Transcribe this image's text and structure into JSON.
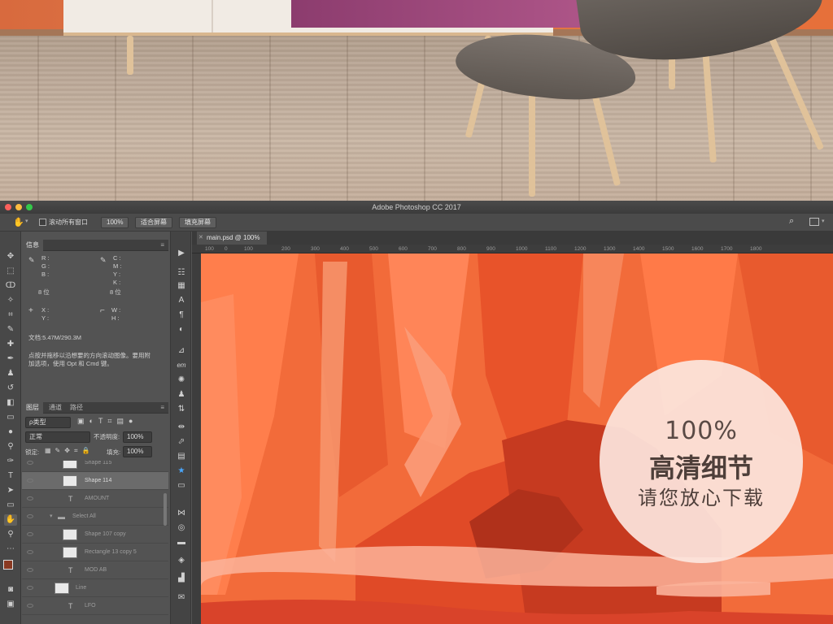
{
  "app": {
    "title": "Adobe Photoshop CC 2017"
  },
  "options_bar": {
    "scroll_all_label": "滚动所有窗口",
    "zoom_value": "100%",
    "fit_screen_label": "适合屏幕",
    "fill_screen_label": "填充屏幕"
  },
  "info_panel": {
    "tab_label": "信息",
    "rgb_labels": "R :\nG :\nB :",
    "cmyk_labels": "C :\nM :\nY :\nK :",
    "bit_left": "8 位",
    "bit_right": "8 位",
    "xy_labels": "X :\nY :",
    "wh_labels": "W :\nH :",
    "doc_size": "文档:5.47M/290.3M",
    "hint": "点按并拖移以沿想要的方向滚动图像。要用附\n加选项，使用 Opt 和 Cmd 键。"
  },
  "layers_panel": {
    "tabs": [
      "图层",
      "通道",
      "路径"
    ],
    "filter_kind": "ρ类型",
    "blend_mode": "正常",
    "opacity_label": "不透明度:",
    "opacity_value": "100%",
    "lock_label": "锁定:",
    "fill_label": "填充:",
    "fill_value": "100%",
    "layers": [
      {
        "name": "Shape 115"
      },
      {
        "name": "Shape 114"
      },
      {
        "name": "AMOUNT"
      },
      {
        "name": "Select All"
      },
      {
        "name": "Shape 107 copy"
      },
      {
        "name": "Rectangle 13 copy 5"
      },
      {
        "name": "MOD AB"
      },
      {
        "name": "Line"
      },
      {
        "name": "LFO"
      }
    ]
  },
  "document": {
    "tab_label": "main.psd @ 100%",
    "ruler_marks": [
      "100",
      "0",
      "100",
      "200",
      "300",
      "400",
      "500",
      "600",
      "700",
      "800",
      "900",
      "1000",
      "1100",
      "1200",
      "1300",
      "1400",
      "1500",
      "1600",
      "1700",
      "1800"
    ]
  },
  "badge": {
    "line1": "100%",
    "line2": "高清细节",
    "line3": "请您放心下载"
  },
  "colors": {
    "canvas_orange": "#f26b3a",
    "canvas_dark_red": "#c63a20",
    "foreground_swatch": "#8a3a22",
    "background_swatch": "#ffffff"
  }
}
